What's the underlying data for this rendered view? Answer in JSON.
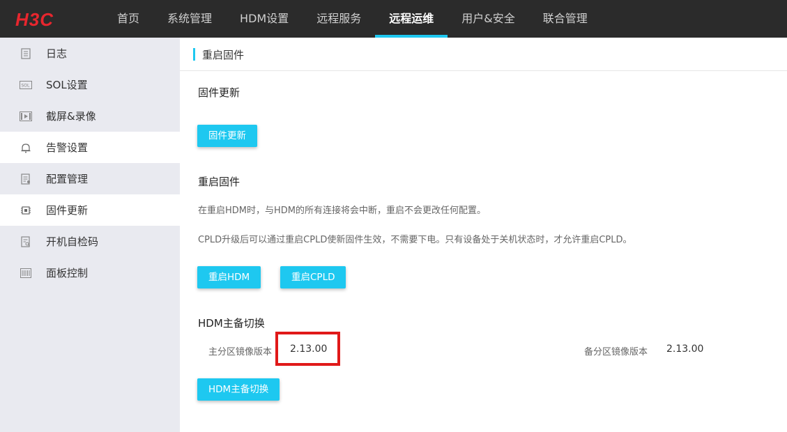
{
  "brand": {
    "logo_text": "H3C",
    "logo_color": "#e8262e"
  },
  "nav": {
    "items": [
      {
        "label": "首页"
      },
      {
        "label": "系统管理"
      },
      {
        "label": "HDM设置"
      },
      {
        "label": "远程服务"
      },
      {
        "label": "远程运维",
        "active": true
      },
      {
        "label": "用户&安全"
      },
      {
        "label": "联合管理"
      }
    ],
    "accent_color": "#1ec8f0"
  },
  "sidebar": {
    "items": [
      {
        "label": "日志",
        "icon": "log-icon"
      },
      {
        "label": "SOL设置",
        "icon": "sol-icon"
      },
      {
        "label": "截屏&录像",
        "icon": "video-icon"
      },
      {
        "label": "告警设置",
        "icon": "bell-icon"
      },
      {
        "label": "配置管理",
        "icon": "config-icon"
      },
      {
        "label": "固件更新",
        "icon": "chip-icon"
      },
      {
        "label": "开机自检码",
        "icon": "post-code-icon"
      },
      {
        "label": "面板控制",
        "icon": "panel-icon"
      }
    ]
  },
  "main": {
    "breadcrumb": "重启固件",
    "firmware_update": {
      "title": "固件更新",
      "button_label": "固件更新"
    },
    "restart_firmware": {
      "title": "重启固件",
      "desc1": "在重启HDM时，与HDM的所有连接将会中断，重启不会更改任何配置。",
      "desc2": "CPLD升级后可以通过重启CPLD使新固件生效，不需要下电。只有设备处于关机状态时，才允许重启CPLD。",
      "restart_hdm_label": "重启HDM",
      "restart_cpld_label": "重启CPLD"
    },
    "hdm_switch": {
      "title": "HDM主备切换",
      "primary_label": "主分区镜像版本",
      "primary_value": "2.13.00",
      "backup_label": "备分区镜像版本",
      "backup_value": "2.13.00",
      "button_label": "HDM主备切换"
    }
  }
}
